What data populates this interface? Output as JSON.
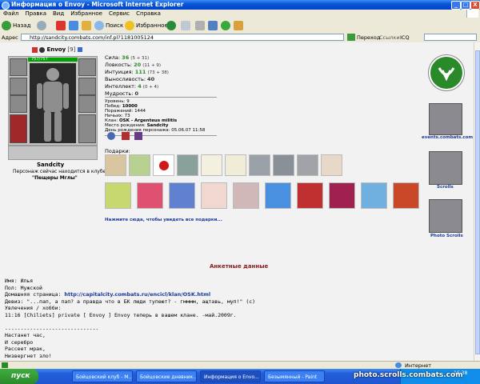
{
  "window": {
    "title": "Информация о Envoy - Microsoft Internet Explorer",
    "min": "_",
    "max": "□",
    "close": "X"
  },
  "menu": [
    "Файл",
    "Правка",
    "Вид",
    "Избранное",
    "Сервис",
    "Справка"
  ],
  "toolbar": {
    "back": "Назад",
    "search": "Поиск",
    "favorites": "Избранное"
  },
  "address": {
    "label": "Адрес",
    "url": "http://sandcity.combats.com/inf.pl?1181005124",
    "go": "Переход",
    "links": "Ссылки",
    "icq": "ICQ"
  },
  "character": {
    "name": "Envoy",
    "level": "[9]",
    "hp": "757/757",
    "stats": [
      {
        "label": "Сила:",
        "value": "36",
        "extra": "(5 + 31)"
      },
      {
        "label": "Ловкость:",
        "value": "20",
        "extra": "(11 + 9)"
      },
      {
        "label": "Интуиция:",
        "value": "111",
        "extra": "(73 + 38)"
      },
      {
        "label": "Выносливость:",
        "value": "40",
        "extra": ""
      },
      {
        "label": "Интеллект:",
        "value": "4",
        "extra": "(0 + 4)"
      },
      {
        "label": "Мудрость:",
        "value": "0",
        "extra": ""
      }
    ],
    "info": [
      {
        "label": "Уровень:",
        "value": "9"
      },
      {
        "label": "Побед:",
        "value": "10000"
      },
      {
        "label": "Поражений:",
        "value": "1444"
      },
      {
        "label": "Ничьих:",
        "value": "73"
      },
      {
        "label": "Клан:",
        "value": "OSK - Argenteus militis"
      },
      {
        "label": "Место рождения:",
        "value": "Sandcity"
      },
      {
        "label": "День рождения персонажа:",
        "value": "05.06.07 11:58"
      }
    ],
    "location_city": "Sandcity",
    "location_text": "Персонаж сейчас находится в клубе.",
    "location_room": "\"Пещеры Мглы\""
  },
  "gifts": {
    "label": "Подарки:",
    "link": "Нажмите сюда, чтобы увидеть все подарки..."
  },
  "sidebar": {
    "events": "events.combats.com",
    "scrolls": "Scrolls",
    "photo": "Photo Scrolls"
  },
  "profile": {
    "heading": "Анкетные данные",
    "name": "Имя: Илья",
    "sex": "Пол: Мужской",
    "homepage_label": "Домашняя страница:",
    "homepage_url": "http://capitalcity.combats.ru/encicl/klan/OSK.html",
    "motto": "Девиз: \"...пап, а пап? а правда что в БК люди тупеют? - гмммм, ащтавь, муп!\" (с)",
    "hobby_label": "Увлечения / хобби:",
    "hobby": "11:16 [Chiliets] private [ Envoy ] Envoy теперь в вашем клане. -май.2009г.",
    "divider": "------------------------------",
    "poem": [
      "Настанет час,",
      "И серебро",
      "Рассеет мрак,",
      "Низвергнет зло!"
    ]
  },
  "statusbar": {
    "zone": "Интернет"
  },
  "taskbar": {
    "start": "пуск",
    "tasks": [
      "Бойцовский клуб - М...",
      "Бойцовские дневник...",
      "Информация о Envo...",
      "Безымянный - Paint"
    ],
    "clock": "16:38"
  },
  "watermark": "photo.scrolls.combats.com"
}
